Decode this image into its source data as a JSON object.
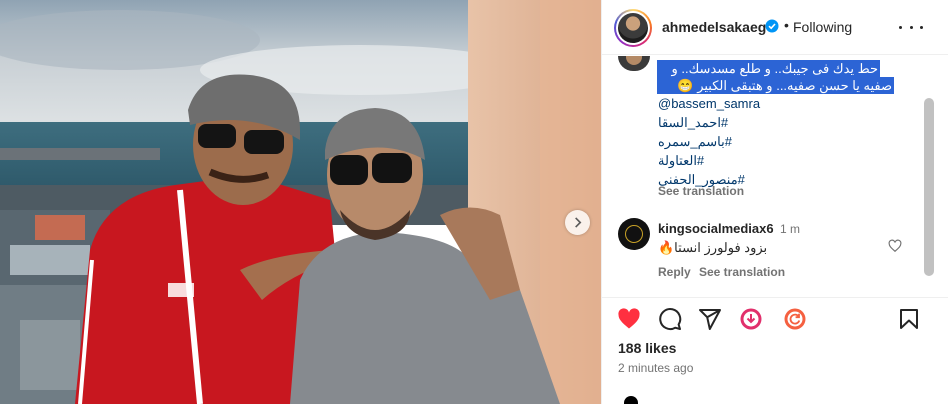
{
  "post": {
    "username": "ahmedelsakaeg",
    "dot": "•",
    "follow_state": "Following",
    "caption_line1": "حط يدك فى جيبك.. و طلع مسدسك.. و",
    "caption_line2": "صفيه يا حسن صفيه... و هتبقى الكبير 😁",
    "mention": "@bassem_samra",
    "hashtags": [
      "#احمد_السقا",
      "#باسم_سمره",
      "#العتاولة",
      "#منصور_الحفنى"
    ],
    "see_translation": "See translation"
  },
  "comment": {
    "username": "kingsocialmediax6",
    "time": "1 m",
    "text": "بزود فولورز انستا🔥",
    "reply": "Reply",
    "see_translation": "See translation"
  },
  "engagement": {
    "likes": "188 likes",
    "posted": "2 minutes ago"
  },
  "colors": {
    "selection": "#2c64d5",
    "link": "#00376b",
    "like_red": "#ff3040",
    "secondary": "#737373"
  },
  "icons": [
    "chevron-right-icon",
    "verified-badge-icon",
    "more-options-icon",
    "heart-icon",
    "comment-icon",
    "share-icon",
    "download-icon",
    "refresh-icon",
    "bookmark-icon"
  ]
}
